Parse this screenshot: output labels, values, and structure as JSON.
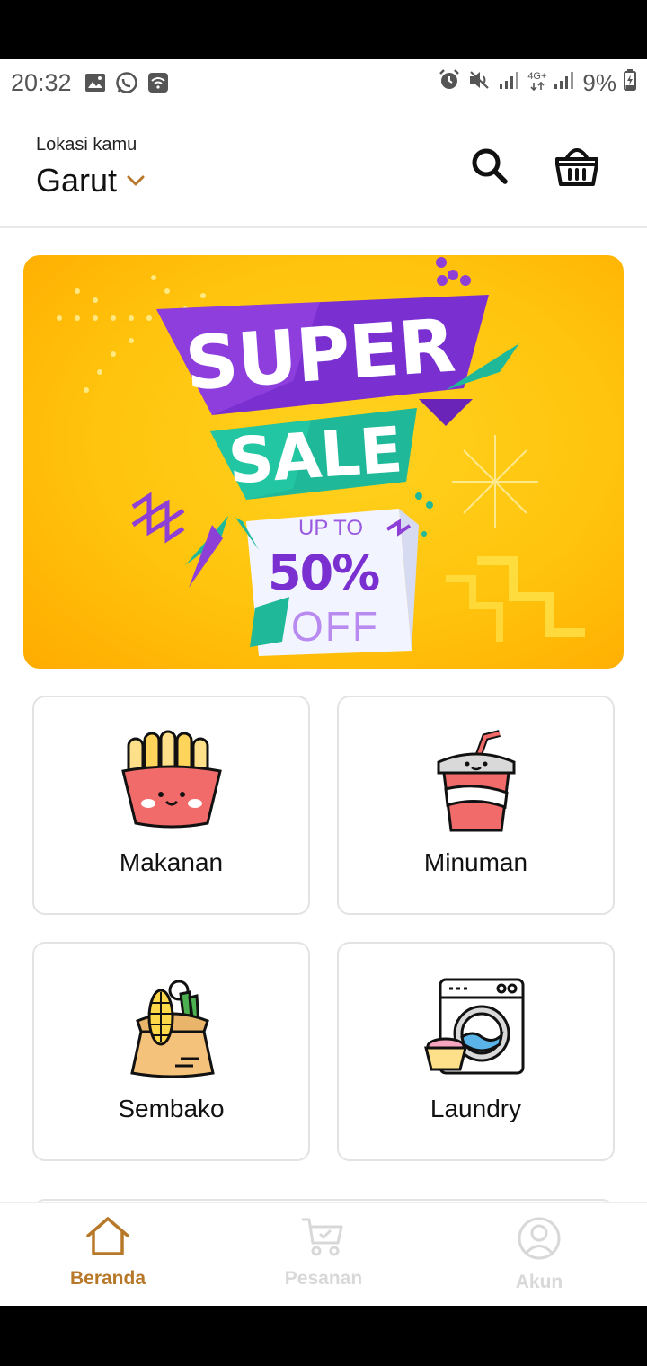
{
  "status_bar": {
    "time": "20:32",
    "battery": "9%",
    "network": "4G+"
  },
  "header": {
    "location_label": "Lokasi kamu",
    "location_city": "Garut"
  },
  "banner": {
    "line1": "SUPER",
    "line2": "SALE",
    "line3": "UP TO",
    "line4": "50%",
    "line5": "OFF"
  },
  "categories": [
    {
      "label": "Makanan",
      "icon": "fries-icon"
    },
    {
      "label": "Minuman",
      "icon": "drink-cup-icon"
    },
    {
      "label": "Sembako",
      "icon": "grocery-sack-icon"
    },
    {
      "label": "Laundry",
      "icon": "washing-machine-icon"
    }
  ],
  "bottom_nav": {
    "items": [
      {
        "label": "Beranda",
        "icon": "home-icon",
        "active": true
      },
      {
        "label": "Pesanan",
        "icon": "cart-icon",
        "active": false
      },
      {
        "label": "Akun",
        "icon": "user-icon",
        "active": false
      }
    ]
  },
  "colors": {
    "accent": "#b8782a",
    "inactive": "#d8d8d8",
    "banner_yellow": "#ffc40d",
    "banner_purple": "#8e3fd6",
    "banner_teal": "#1fb99a"
  }
}
